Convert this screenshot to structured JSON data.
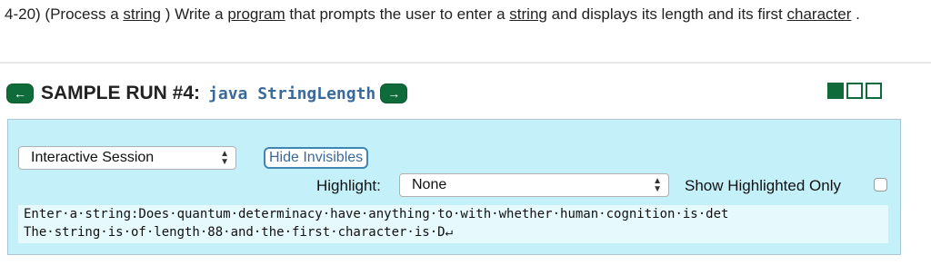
{
  "problem": {
    "part1": "4-20) (Process a ",
    "link1": "string",
    "part2": " ) Write a ",
    "link2": "program",
    "part3": "  that prompts the user to enter a ",
    "link3": "string",
    "part4": "  and displays its length and its first ",
    "link4": "character",
    "part5": " ."
  },
  "run": {
    "prev_icon": "←",
    "title": "SAMPLE RUN #4:",
    "command": "java StringLength",
    "next_icon": "→"
  },
  "panel": {
    "session_select": {
      "value": "Interactive Session",
      "arrows": "▲▼"
    },
    "hide_button_label": "Hide Invisibles",
    "highlight_label": "Highlight:",
    "highlight_select": {
      "value": "None",
      "arrows": "▲▼"
    },
    "show_highlighted_label": "Show Highlighted Only",
    "console_lines": [
      "Enter·a·string:Does·quantum·determinacy·have·anything·to·with·whether·human·cognition·is·det",
      "The·string·is·of·length·88·and·the·first·character·is·D↵"
    ]
  },
  "colors": {
    "accent_green": "#0f6b3a",
    "panel_bg": "#c4f0fa",
    "console_bg": "#e6f9fd",
    "command_blue": "#3a6a9a"
  },
  "icons": {
    "prev": "arrow-left-icon",
    "next": "arrow-right-icon",
    "view_toggles": [
      "view-square-filled-icon",
      "view-square-empty-icon",
      "view-square-empty-icon"
    ]
  }
}
